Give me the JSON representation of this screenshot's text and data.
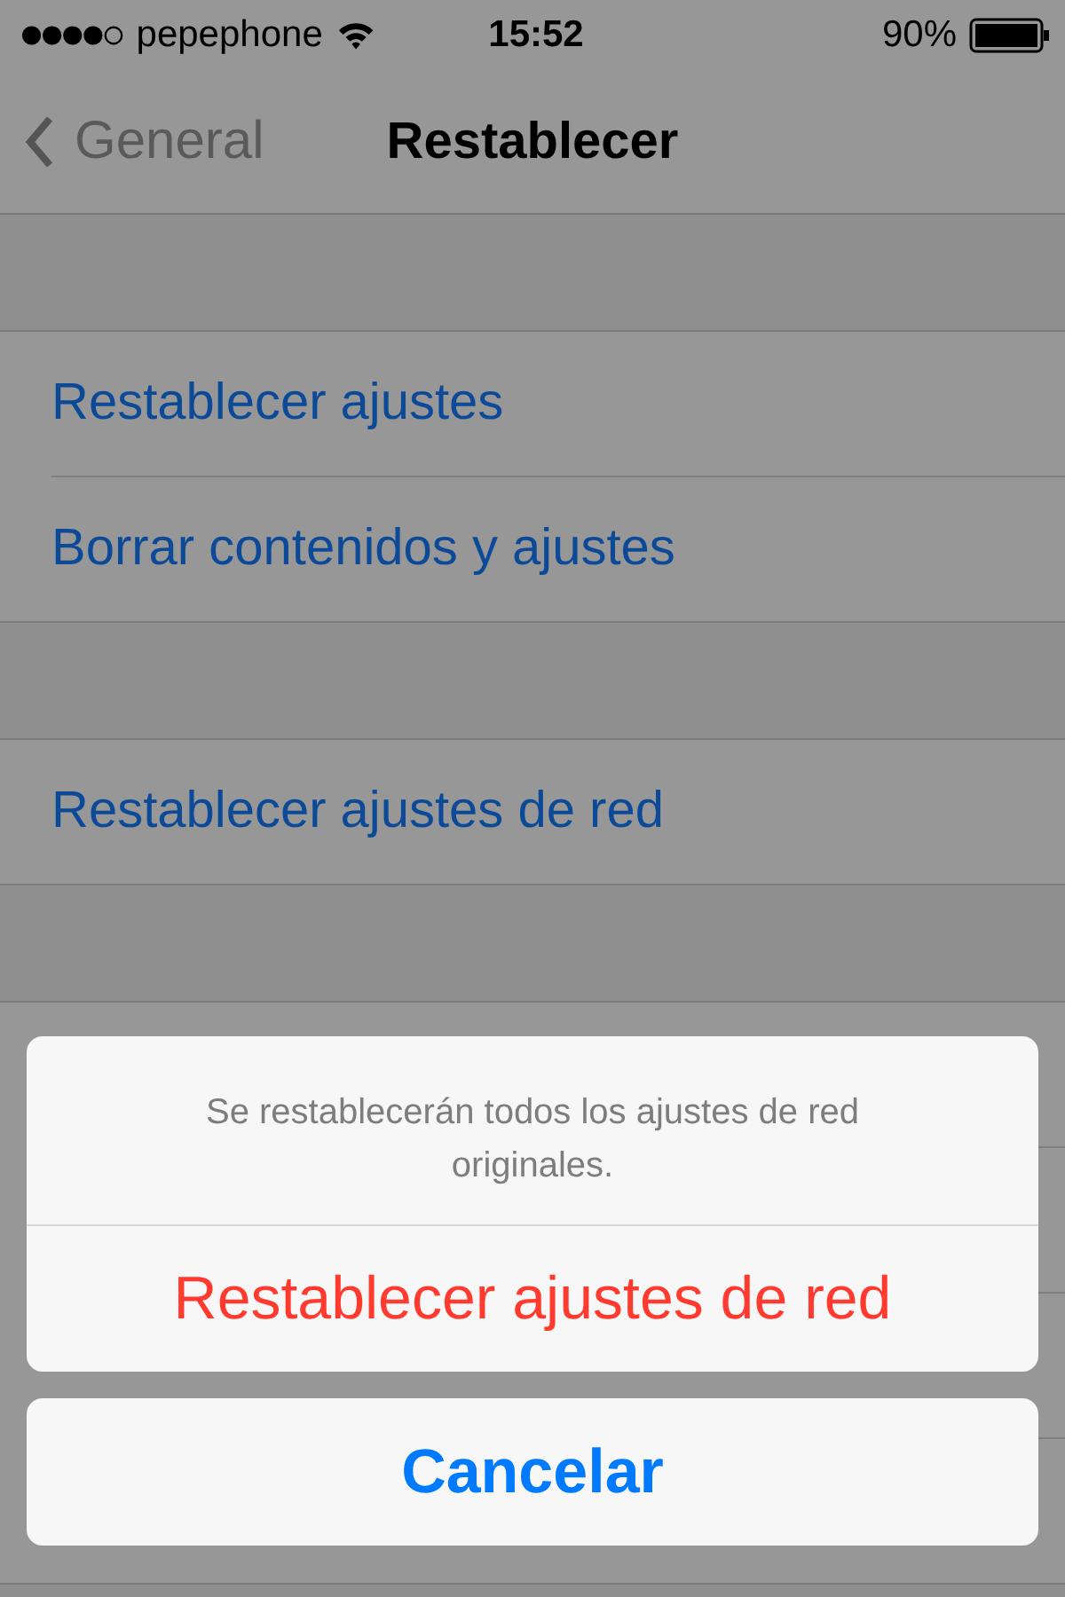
{
  "status_bar": {
    "carrier": "pepephone",
    "time": "15:52",
    "battery": "90%"
  },
  "nav": {
    "back": "General",
    "title": "Restablecer"
  },
  "groups": [
    {
      "rows": [
        {
          "label": "Restablecer ajustes"
        },
        {
          "label": "Borrar contenidos y ajustes"
        }
      ]
    },
    {
      "rows": [
        {
          "label": "Restablecer ajustes de red"
        }
      ]
    }
  ],
  "action_sheet": {
    "message": "Se restablecerán todos los ajustes de red originales.",
    "actions": [
      {
        "label": "Restablecer ajustes de red",
        "kind": "destructive"
      }
    ],
    "cancel": "Cancelar"
  }
}
